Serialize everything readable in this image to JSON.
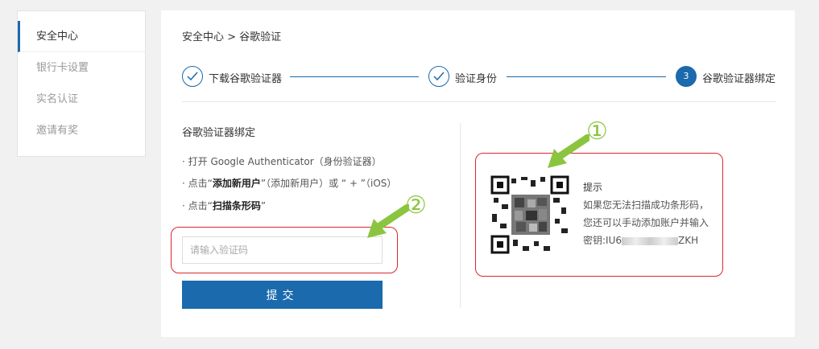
{
  "sidebar": {
    "items": [
      {
        "label": "安全中心"
      },
      {
        "label": "银行卡设置"
      },
      {
        "label": "实名认证"
      },
      {
        "label": "邀请有奖"
      }
    ]
  },
  "breadcrumb": "安全中心 > 谷歌验证",
  "steps": [
    {
      "label": "下载谷歌验证器"
    },
    {
      "label": "验证身份"
    },
    {
      "label": "谷歌验证器绑定",
      "number": "3"
    }
  ],
  "bind": {
    "title": "谷歌验证器绑定",
    "instructions": [
      {
        "prefix": "· 打开 Google Authenticator（身份验证器）",
        "bold": "",
        "suffix": ""
      },
      {
        "prefix": "· 点击“",
        "bold": "添加新用户",
        "suffix": "”（添加新用户）或 “ + ”（iOS）"
      },
      {
        "prefix": "· 点击“",
        "bold": "扫描条形码",
        "suffix": "”"
      }
    ],
    "input_placeholder": "请输入验证码",
    "submit_label": "提交"
  },
  "tip": {
    "title": "提示",
    "line1": "如果您无法扫描成功条形码，",
    "line2": "您还可以手动添加账户并输入",
    "key_prefix": "密钥:IU6",
    "key_suffix": "ZKH"
  },
  "annotations": {
    "one": "①",
    "two": "②"
  },
  "colors": {
    "accent": "#1a6aad",
    "highlight": "#d9272e",
    "annotation": "#8bc53f"
  }
}
